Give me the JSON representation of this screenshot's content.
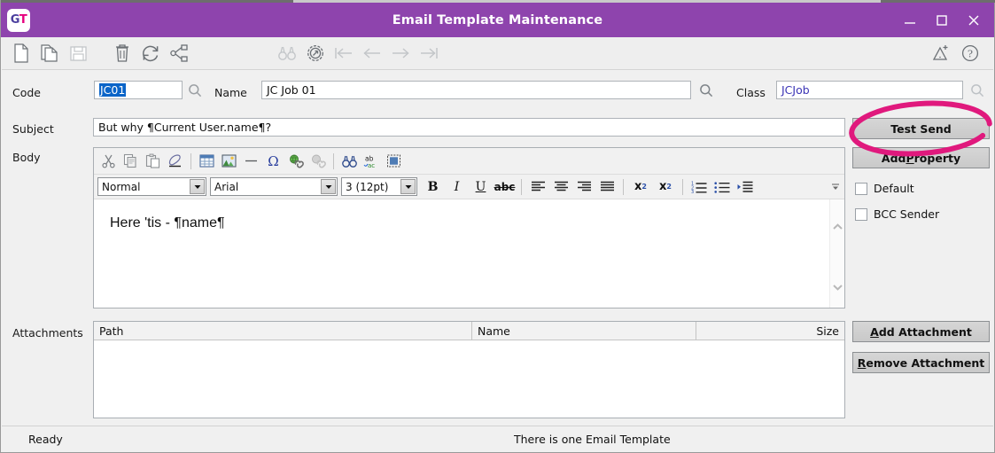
{
  "window": {
    "logo_text_g": "G",
    "logo_text_t": "T",
    "title": "Email Template Maintenance",
    "minimize_label": "Minimize",
    "maximize_label": "Maximize",
    "close_label": "Close",
    "accent_color": "#8e44ad"
  },
  "toolbar": {
    "items": [
      {
        "name": "new-icon",
        "label": "New",
        "enabled": true
      },
      {
        "name": "copy-record-icon",
        "label": "Copy",
        "enabled": true
      },
      {
        "name": "save-icon",
        "label": "Save",
        "enabled": false
      },
      {
        "name": "delete-icon",
        "label": "Delete",
        "enabled": true
      },
      {
        "name": "refresh-icon",
        "label": "Refresh",
        "enabled": true
      },
      {
        "name": "workflow-icon",
        "label": "Workflow",
        "enabled": true
      },
      {
        "name": "find-icon",
        "label": "Find",
        "enabled": false
      },
      {
        "name": "locate-icon",
        "label": "Locate",
        "enabled": true
      },
      {
        "name": "first-record-icon",
        "label": "First",
        "enabled": false
      },
      {
        "name": "previous-record-icon",
        "label": "Previous",
        "enabled": false
      },
      {
        "name": "next-record-icon",
        "label": "Next",
        "enabled": false
      },
      {
        "name": "last-record-icon",
        "label": "Last",
        "enabled": false
      },
      {
        "name": "warning-icon",
        "label": "Warnings",
        "enabled": true
      },
      {
        "name": "help-icon",
        "label": "Help",
        "enabled": true
      }
    ]
  },
  "form": {
    "code_label": "Code",
    "code_value": "JC01",
    "code_selected": true,
    "name_label": "Name",
    "name_value": "JC Job 01",
    "class_label": "Class",
    "class_value": "JCJob",
    "subject_label": "Subject",
    "subject_value": "But why ¶Current User.name¶?",
    "body_label": "Body",
    "attachments_label": "Attachments"
  },
  "actions": {
    "test_send": "Test Send",
    "add_property_pre": "Add ",
    "add_property_key": "P",
    "add_property_post": "roperty",
    "add_attachment_key": "A",
    "add_attachment_post": "dd Attachment",
    "remove_attachment_key": "R",
    "remove_attachment_post": "emove Attachment"
  },
  "options": {
    "default_label": "Default",
    "default_checked": false,
    "bcc_sender_label": "BCC Sender",
    "bcc_sender_checked": false
  },
  "editor": {
    "row1": [
      {
        "name": "cut-icon",
        "label": "Cut"
      },
      {
        "name": "copy-icon",
        "label": "Copy"
      },
      {
        "name": "paste-icon",
        "label": "Paste"
      },
      {
        "name": "erase-format-icon",
        "label": "Remove Formatting"
      },
      {
        "name": "insert-table-icon",
        "label": "Insert Table"
      },
      {
        "name": "insert-image-icon",
        "label": "Insert Image"
      },
      {
        "name": "horizontal-rule-icon",
        "label": "Horizontal Rule"
      },
      {
        "name": "special-character-icon",
        "label": "Special Character"
      },
      {
        "name": "insert-link-icon",
        "label": "Insert Link"
      },
      {
        "name": "remove-link-icon",
        "label": "Remove Link"
      },
      {
        "name": "find-replace-icon",
        "label": "Find and Replace"
      },
      {
        "name": "spell-check-icon",
        "label": "Spell Check"
      },
      {
        "name": "select-all-icon",
        "label": "Select All"
      }
    ],
    "style_value": "Normal",
    "font_value": "Arial",
    "size_value": "3 (12pt)",
    "bold_label": "B",
    "italic_label": "I",
    "underline_label": "U",
    "strike_label": "abc",
    "superscript_label": "x",
    "superscript_sup": "2",
    "subscript_label": "x",
    "subscript_sub": "2",
    "row2_icons": [
      {
        "name": "align-left-icon",
        "label": "Align Left"
      },
      {
        "name": "align-center-icon",
        "label": "Align Center"
      },
      {
        "name": "align-right-icon",
        "label": "Align Right"
      },
      {
        "name": "align-justify-icon",
        "label": "Justify"
      },
      {
        "name": "ordered-list-icon",
        "label": "Numbered List"
      },
      {
        "name": "unordered-list-icon",
        "label": "Bulleted List"
      },
      {
        "name": "indent-icon",
        "label": "Increase Indent"
      },
      {
        "name": "toolbar-overflow-icon",
        "label": "More"
      }
    ],
    "body_text": "Here 'tis - ¶name¶"
  },
  "grid": {
    "columns": [
      "Path",
      "Name",
      "Size"
    ],
    "rows": []
  },
  "status": {
    "left": "Ready",
    "center": "There is one Email Template"
  },
  "annotation": {
    "shape": "ellipse-highlight",
    "color": "#e0197d",
    "targets": "Test Send"
  }
}
